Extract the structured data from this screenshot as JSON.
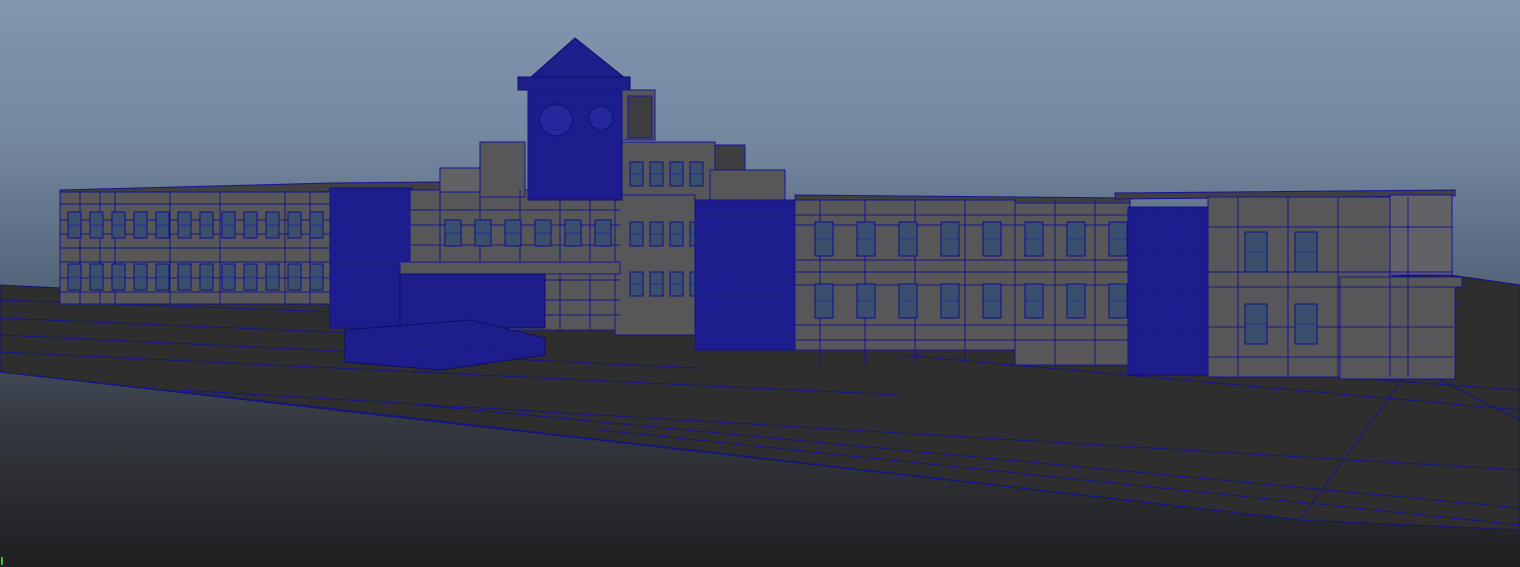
{
  "viewport": {
    "label": "",
    "background_top": "#8296b0",
    "background_bottom": "#1f1f21",
    "wireframe_color": "#141496",
    "shaded_color": "#57575a",
    "display_mode": "wireframe-on-shaded"
  },
  "scene": {
    "subject": "building-model"
  },
  "axis": {
    "y_color": "#3ec23e"
  }
}
